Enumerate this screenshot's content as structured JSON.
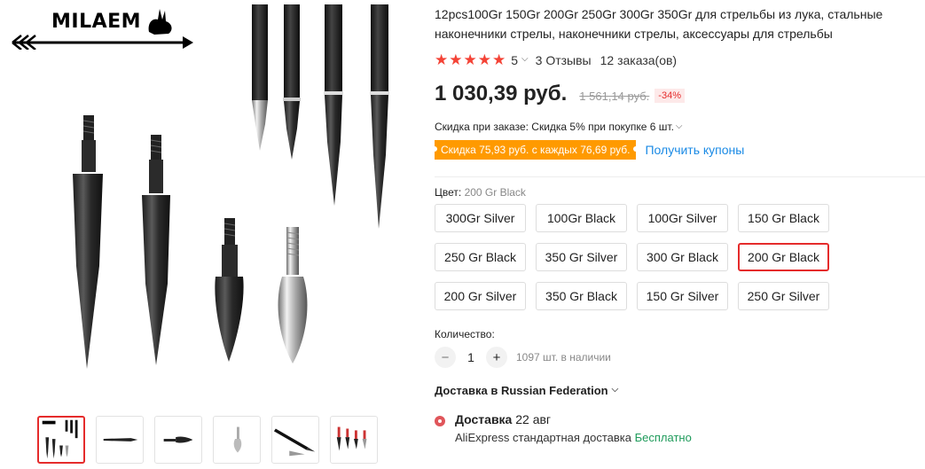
{
  "brand": {
    "logo_text": "MILAEM",
    "logo_icon": "rabbit-arrow-logo"
  },
  "product": {
    "title": "12pcs100Gr 150Gr 200Gr 250Gr 300Gr 350Gr для стрельбы из лука, стальные наконечники стрелы, наконечники стрелы, аксессуары для стрельбы",
    "rating": {
      "stars": 5,
      "value": "5",
      "reviews": "3 Отзывы",
      "orders": "12 заказа(ов)"
    },
    "price": {
      "current": "1 030,39 руб.",
      "old": "1 561,14 руб.",
      "discount": "-34%"
    },
    "order_discount": "Скидка при заказе: Скидка 5% при покупке 6 шт.",
    "coupon": {
      "badge": "Скидка 75,93 руб. с каждых 76,69 руб.",
      "link": "Получить купоны"
    },
    "color": {
      "label": "Цвет: ",
      "selected": "200 Gr Black",
      "options": [
        "300Gr Silver",
        "100Gr Black",
        "100Gr Silver",
        "150 Gr Black",
        "250 Gr Black",
        "350 Gr Silver",
        "300 Gr Black",
        "200 Gr Black",
        "200 Gr Silver",
        "350 Gr Black",
        "150 Gr Silver",
        "250 Gr Silver"
      ]
    },
    "quantity": {
      "label": "Количество:",
      "minus": "−",
      "value": "1",
      "plus": "+",
      "stock": "1097 шт. в наличии"
    },
    "shipping": {
      "title": "Доставка в Russian Federation",
      "method_label": "Доставка",
      "date": "22 авг",
      "carrier": "AliExpress стандартная доставка",
      "price": "Бесплатно"
    }
  },
  "gallery": {
    "thumbnails": [
      "all-tips",
      "long-black-tip",
      "black-bullet-tip",
      "silver-bullet-tip",
      "arrow-shafts",
      "tips-with-scale"
    ],
    "active_index": 0
  },
  "colors": {
    "accent": "#e52b2b",
    "star": "#f44336",
    "coupon": "#ff9a00",
    "link": "#1a8ae5",
    "free": "#1f9b5b"
  }
}
